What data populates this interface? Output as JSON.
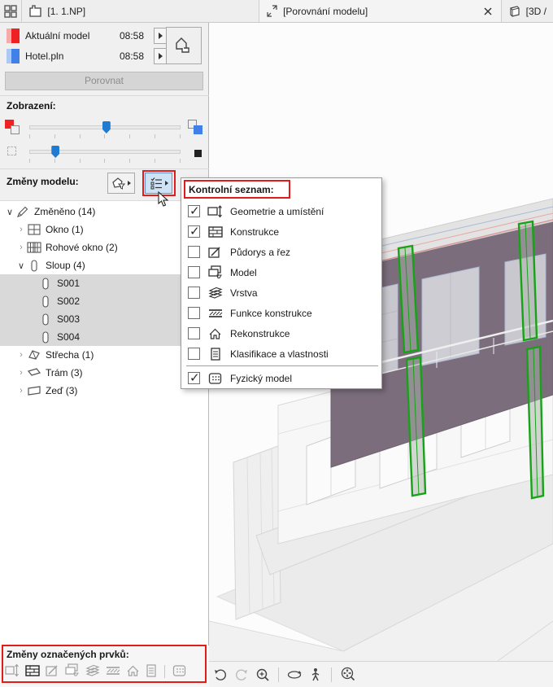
{
  "tab_bar": {
    "tabs": [
      {
        "label": "[1. 1.NP]"
      },
      {
        "label": "[Porovnání modelu]"
      },
      {
        "label": "[3D /"
      }
    ]
  },
  "panel": {
    "models": [
      {
        "name": "Aktuální model",
        "time": "08:58",
        "color": "#ee2222",
        "color_light": "#f6abab"
      },
      {
        "name": "Hotel.pln",
        "time": "08:58",
        "color": "#4180e8",
        "color_light": "#adc9f2"
      }
    ],
    "compare_button": "Porovnat",
    "display_title": "Zobrazení:",
    "sliders": [
      {
        "percent": 51
      },
      {
        "percent": 17
      }
    ],
    "changes_title": "Změny modelu:",
    "tree": [
      {
        "caret": "∨",
        "label": "Změněno (14)",
        "icon": "pencil-icon"
      },
      {
        "caret": "›",
        "label": "Okno (1)",
        "icon": "window-icon"
      },
      {
        "caret": "›",
        "label": "Rohové okno (2)",
        "icon": "corner-window-icon"
      },
      {
        "caret": "∨",
        "label": "Sloup (4)",
        "icon": "column-icon"
      },
      {
        "label": "S001",
        "icon": "column-icon",
        "selected": true
      },
      {
        "label": "S002",
        "icon": "column-icon",
        "selected": true
      },
      {
        "label": "S003",
        "icon": "column-icon",
        "selected": true
      },
      {
        "label": "S004",
        "icon": "column-icon",
        "selected": true
      },
      {
        "caret": "›",
        "label": "Střecha (1)",
        "icon": "roof-icon"
      },
      {
        "caret": "›",
        "label": "Trám (3)",
        "icon": "beam-icon"
      },
      {
        "caret": "›",
        "label": "Zeď (3)",
        "icon": "wall-icon"
      }
    ],
    "selected_changes_title": "Změny označených prvků:"
  },
  "popup": {
    "title": "Kontrolní seznam:",
    "items": [
      {
        "label": "Geometrie a umístění",
        "checked": true,
        "icon": "geometry-icon"
      },
      {
        "label": "Konstrukce",
        "checked": true,
        "icon": "construction-icon"
      },
      {
        "label": "Půdorys a řez",
        "checked": false,
        "icon": "plan-section-icon"
      },
      {
        "label": "Model",
        "checked": false,
        "icon": "model-icon"
      },
      {
        "label": "Vrstva",
        "checked": false,
        "icon": "layer-icon"
      },
      {
        "label": "Funkce konstrukce",
        "checked": false,
        "icon": "structural-function-icon"
      },
      {
        "label": "Rekonstrukce",
        "checked": false,
        "icon": "renovation-icon"
      },
      {
        "label": "Klasifikace a vlastnosti",
        "checked": false,
        "icon": "classification-icon"
      },
      {
        "label": "Fyzický model",
        "checked": true,
        "icon": "physical-model-icon"
      }
    ]
  },
  "colors": {
    "annotation_red": "#e21b1b",
    "accent_blue": "#1f7ad1",
    "selection_gray": "#d9d9d9",
    "column_green": "#17a317",
    "wall_purple": "#7b6d7c"
  }
}
